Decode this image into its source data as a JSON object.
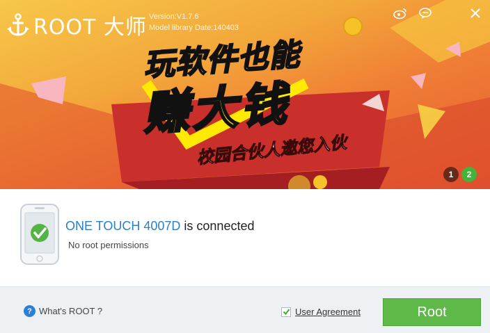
{
  "app": {
    "brand_name": "ROOT 大师",
    "version": "Version:V1.7.6",
    "model_library_date": "Model library Date:140403"
  },
  "window_controls": {
    "weibo": "weibo-icon",
    "feedback": "chat-icon",
    "close": "close-icon"
  },
  "banner": {
    "line1": "玩软件也能",
    "line2": "赚大钱",
    "line3": "校园合伙人邀您入伙",
    "pager": [
      "1",
      "2"
    ],
    "active_page": "2"
  },
  "device": {
    "model": "ONE TOUCH 4007D",
    "status_suffix": " is connected",
    "permission_status": "No root permissions"
  },
  "footer": {
    "help_label": "What's ROOT ?",
    "agreement_label": "User Agreement",
    "agreement_checked": true,
    "root_button_label": "Root"
  },
  "colors": {
    "accent_green": "#5fb948",
    "link_blue": "#2a7fc7",
    "banner_orange": "#ef7d35"
  }
}
